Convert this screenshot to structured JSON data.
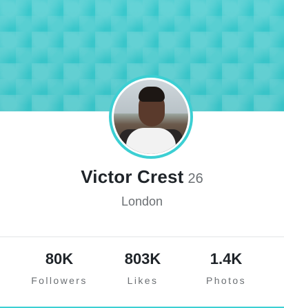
{
  "profile": {
    "name": "Victor Crest",
    "age": "26",
    "city": "London"
  },
  "stats": [
    {
      "value": "80K",
      "label": "Followers"
    },
    {
      "value": "803K",
      "label": "Likes"
    },
    {
      "value": "1.4K",
      "label": "Photos"
    }
  ],
  "colors": {
    "accent": "#3ccfd3",
    "text_primary": "#1f2429",
    "text_secondary": "#6b6f73",
    "divider": "#e3e5e7"
  }
}
